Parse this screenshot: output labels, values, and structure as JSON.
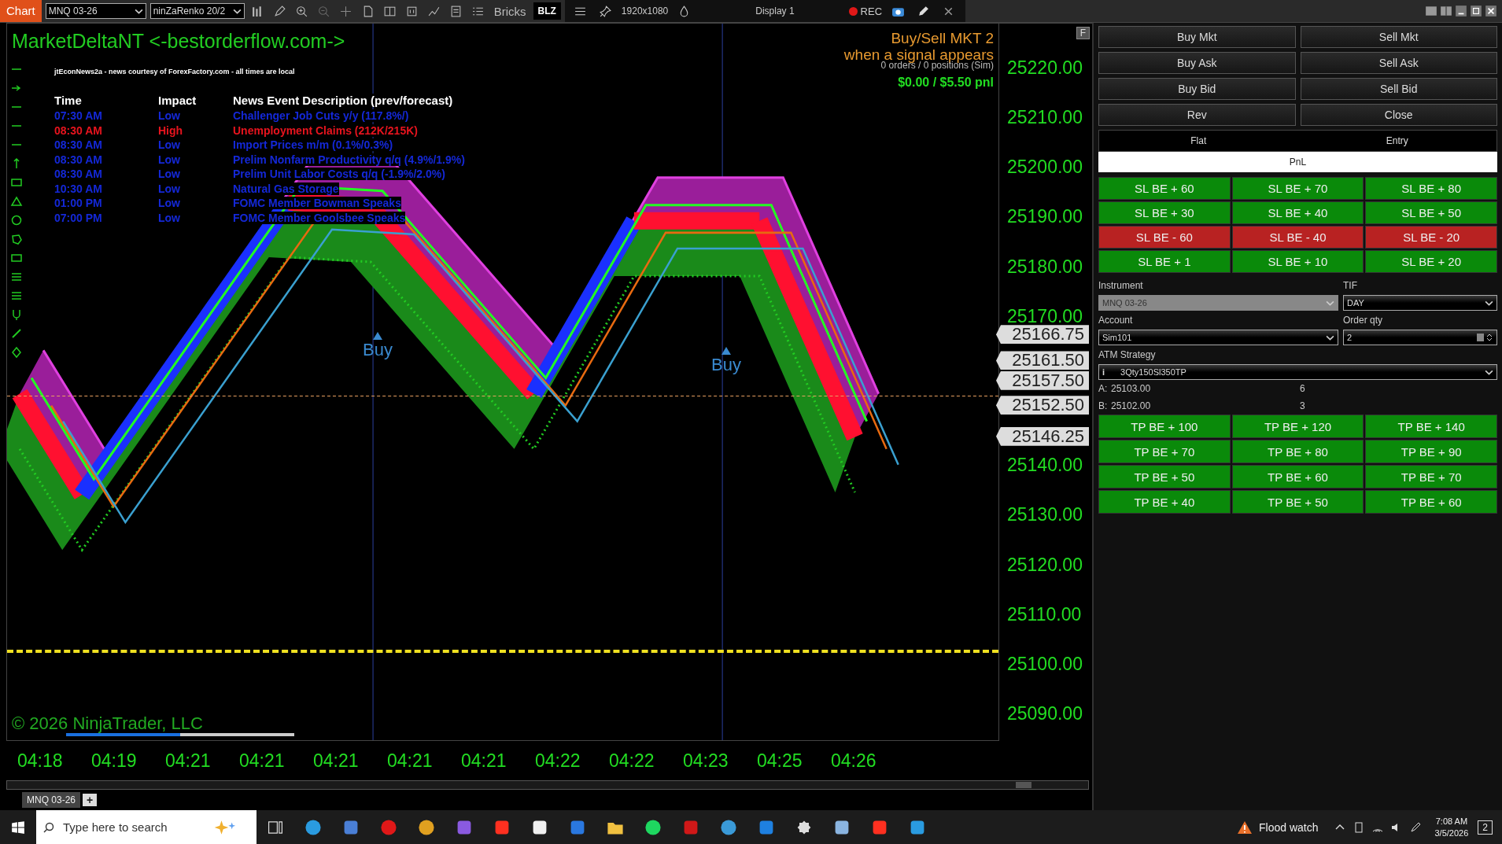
{
  "toolbar": {
    "tab": "Chart",
    "instrument": "MNQ 03-26",
    "bar_type": "ninZaRenko 20/2",
    "bricks": "Bricks",
    "blz": "BLZ",
    "resolution": "1920x1080",
    "display": "Display 1",
    "rec": "REC"
  },
  "chart": {
    "title": "MarketDeltaNT <-bestorderflow.com->",
    "news_source": "jtEconNews2a - news courtesy of ForexFactory.com - all times are local",
    "news_columns": [
      "Time",
      "Impact",
      "News Event Description (prev/forecast)"
    ],
    "news_rows": [
      {
        "time": "07:30 AM",
        "impact": "Low",
        "event": "Challenger Job Cuts y/y (117.8%/)",
        "color": "#1428d8"
      },
      {
        "time": "08:30 AM",
        "impact": "High",
        "event": "Unemployment Claims (212K/215K)",
        "color": "#e8141e"
      },
      {
        "time": "08:30 AM",
        "impact": "Low",
        "event": "Import Prices m/m (0.1%/0.3%)",
        "color": "#1428d8"
      },
      {
        "time": "08:30 AM",
        "impact": "Low",
        "event": "Prelim Nonfarm Productivity q/q (4.9%/1.9%)",
        "color": "#1428d8"
      },
      {
        "time": "08:30 AM",
        "impact": "Low",
        "event": "Prelim Unit Labor Costs q/q (-1.9%/2.0%)",
        "color": "#1428d8"
      },
      {
        "time": "10:30 AM",
        "impact": "Low",
        "event": "Natural Gas Storage",
        "color": "#1428d8"
      },
      {
        "time": "01:00 PM",
        "impact": "Low",
        "event": "FOMC Member Bowman Speaks",
        "color": "#1428d8"
      },
      {
        "time": "07:00 PM",
        "impact": "Low",
        "event": "FOMC Member Goolsbee Speaks",
        "color": "#1428d8"
      }
    ],
    "signal_line1": "Buy/Sell MKT 2",
    "signal_line2": "when a signal appears",
    "orders": "0 orders / 0 positions (Sim)",
    "pnl": "$0.00 / $5.50 pnl",
    "corner_button": "F",
    "signals": [
      {
        "label": "Buy"
      },
      {
        "label": "Buy"
      }
    ],
    "copyright": "© 2026 NinjaTrader, LLC",
    "progress": {
      "level": 0.5
    },
    "price_ticks": [
      "25220.00",
      "25210.00",
      "25200.00",
      "25190.00",
      "25180.00",
      "25170.00",
      "25140.00",
      "25130.00",
      "25120.00",
      "25110.00",
      "25100.00",
      "25090.00"
    ],
    "price_markers": [
      "25166.75",
      "25161.50",
      "25157.50",
      "25152.50",
      "25146.25"
    ],
    "time_labels": [
      "04:18",
      "04:19",
      "04:21",
      "04:21",
      "04:21",
      "04:21",
      "04:21",
      "04:22",
      "04:22",
      "04:23",
      "04:25",
      "04:26"
    ]
  },
  "tab_strip": {
    "tab": "MNQ 03-26",
    "add": "+"
  },
  "panel": {
    "top_buttons": [
      "Buy Mkt",
      "Sell Mkt",
      "Buy Ask",
      "Sell Ask",
      "Buy Bid",
      "Sell Bid",
      "Rev",
      "Close"
    ],
    "status": [
      "Flat",
      "Entry"
    ],
    "pnl": "PnL",
    "sl_buttons": [
      {
        "label": "SL BE + 60",
        "color": "#0a8a0a"
      },
      {
        "label": "SL BE + 70",
        "color": "#0a8a0a"
      },
      {
        "label": "SL BE + 80",
        "color": "#0a8a0a"
      },
      {
        "label": "SL BE + 30",
        "color": "#0a8a0a"
      },
      {
        "label": "SL BE + 40",
        "color": "#0a8a0a"
      },
      {
        "label": "SL BE + 50",
        "color": "#0a8a0a"
      },
      {
        "label": "SL BE - 60",
        "color": "#b82222"
      },
      {
        "label": "SL BE - 40",
        "color": "#b82222"
      },
      {
        "label": "SL BE - 20",
        "color": "#b82222"
      },
      {
        "label": "SL BE + 1",
        "color": "#0a8a0a"
      },
      {
        "label": "SL BE + 10",
        "color": "#0a8a0a"
      },
      {
        "label": "SL BE + 20",
        "color": "#0a8a0a"
      }
    ],
    "instrument": {
      "label": "Instrument",
      "value": "MNQ 03-26",
      "disabled": true
    },
    "tif": {
      "label": "TIF",
      "value": "DAY"
    },
    "account": {
      "label": "Account",
      "value": "Sim101"
    },
    "order_qty": {
      "label": "Order qty",
      "value": "2"
    },
    "atm": {
      "label": "ATM Strategy",
      "info": "i",
      "value": "3Qty150Sl350TP"
    },
    "quotes": [
      {
        "label": "A:",
        "price": "25103.00",
        "size": "6"
      },
      {
        "label": "B:",
        "price": "25102.00",
        "size": "3"
      }
    ],
    "tp_buttons": [
      "TP BE + 100",
      "TP BE + 120",
      "TP BE + 140",
      "TP BE + 70",
      "TP BE + 80",
      "TP BE + 90",
      "TP BE + 50",
      "TP BE + 60",
      "TP BE + 70",
      "TP BE + 40",
      "TP BE + 50",
      "TP BE + 60"
    ]
  },
  "taskbar": {
    "search_placeholder": "Type here to search",
    "weather": "Flood watch",
    "time": "7:08 AM",
    "date": "3/5/2026",
    "notifications": "2"
  }
}
